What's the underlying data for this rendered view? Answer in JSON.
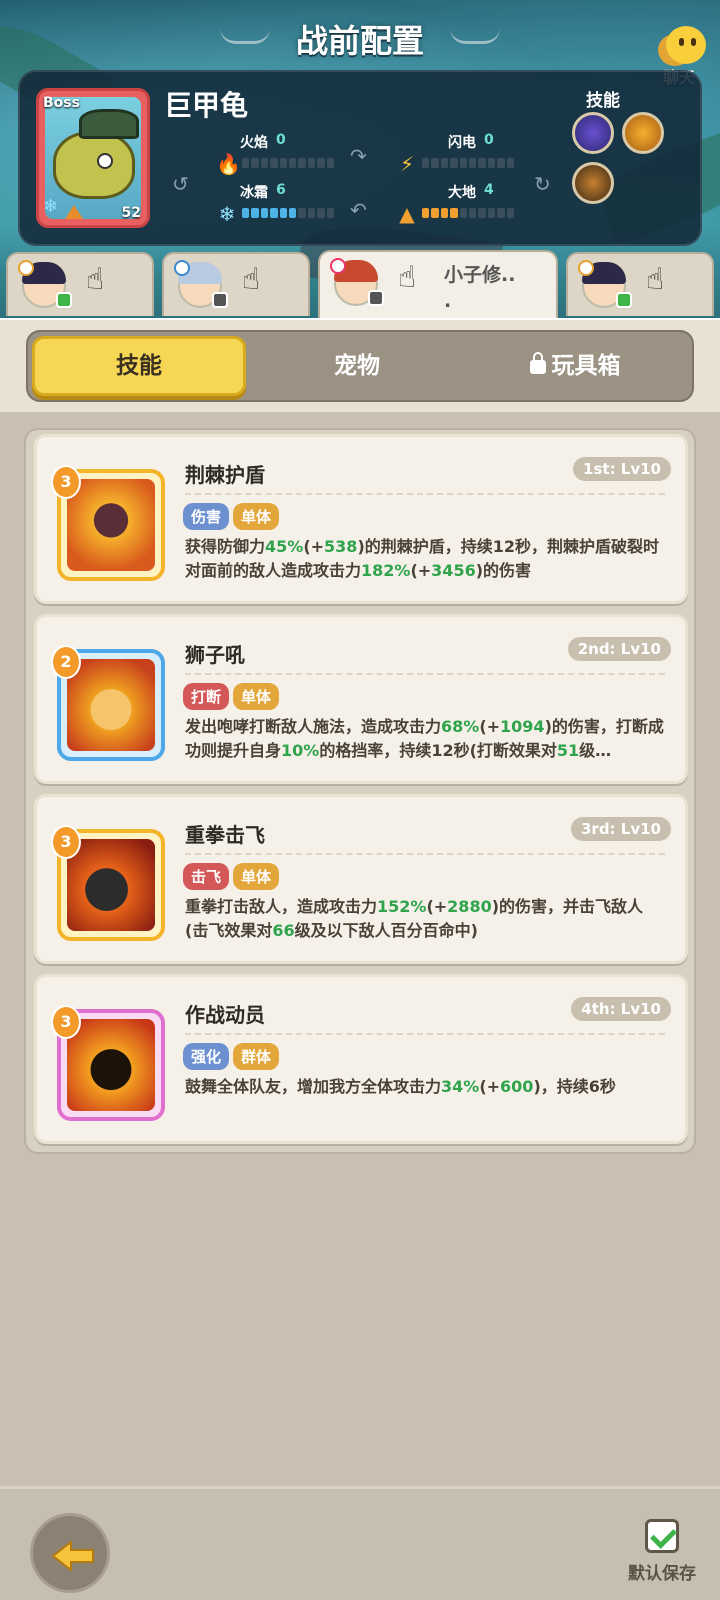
{
  "header": {
    "title": "战前配置",
    "chat_label": "聊天"
  },
  "boss": {
    "tag": "Boss",
    "name": "巨甲龟",
    "level": "52",
    "skills_label": "技能",
    "elements": [
      {
        "name": "火焰",
        "value": "0",
        "filled": 0,
        "icon": "fire-icon"
      },
      {
        "name": "闪电",
        "value": "0",
        "filled": 0,
        "icon": "lightning-icon"
      },
      {
        "name": "冰霜",
        "value": "6",
        "filled": 6,
        "icon": "frost-icon"
      },
      {
        "name": "大地",
        "value": "4",
        "filled": 4,
        "icon": "earth-icon"
      }
    ]
  },
  "heroes": [
    {
      "name": "",
      "hair": "#2c2848",
      "badge": "#3db54a"
    },
    {
      "name": "",
      "hair": "#b8cbe0",
      "badge": "#555"
    },
    {
      "name": "小子修..\n.",
      "hair": "#c84a2e",
      "badge": "#555",
      "active": true
    },
    {
      "name": "",
      "hair": "#2c2848",
      "badge": "#3db54a"
    }
  ],
  "tabs": {
    "skills": "技能",
    "pets": "宠物",
    "toybox": "玩具箱"
  },
  "skills": [
    {
      "level": "3",
      "name": "荆棘护盾",
      "rank": "1st: Lv10",
      "tags": [
        [
          "伤害",
          "blue"
        ],
        [
          "单体",
          "orange"
        ]
      ],
      "desc": [
        [
          "获得防御力",
          ""
        ],
        [
          "45%",
          "g"
        ],
        [
          "(+",
          ""
        ],
        [
          "538",
          "g"
        ],
        [
          ")的荆棘护盾，持续12秒，荆棘护盾破裂时对面前的敌人造成攻击力",
          ""
        ],
        [
          "182%",
          "g"
        ],
        [
          "(+",
          ""
        ],
        [
          "3456",
          "g"
        ],
        [
          ")的伤害",
          ""
        ]
      ]
    },
    {
      "level": "2",
      "name": "狮子吼",
      "rank": "2nd: Lv10",
      "tags": [
        [
          "打断",
          "red"
        ],
        [
          "单体",
          "orange"
        ]
      ],
      "desc": [
        [
          "发出咆哮打断敌人施法，造成攻击力",
          ""
        ],
        [
          "68%",
          "g"
        ],
        [
          "(+",
          ""
        ],
        [
          "1094",
          "g"
        ],
        [
          ")的伤害，打断成功则提升自身",
          ""
        ],
        [
          "10%",
          "g"
        ],
        [
          "的格挡率，持续12秒(打断效果对",
          ""
        ],
        [
          "51",
          "g"
        ],
        [
          "级…",
          ""
        ]
      ]
    },
    {
      "level": "3",
      "name": "重拳击飞",
      "rank": "3rd: Lv10",
      "tags": [
        [
          "击飞",
          "red"
        ],
        [
          "单体",
          "orange"
        ]
      ],
      "desc": [
        [
          "重拳打击敌人，造成攻击力",
          ""
        ],
        [
          "152%",
          "g"
        ],
        [
          "(+",
          ""
        ],
        [
          "2880",
          "g"
        ],
        [
          ")的伤害，并击飞敌人(击飞效果对",
          ""
        ],
        [
          "66",
          "g"
        ],
        [
          "级及以下敌人百分百命中)",
          ""
        ]
      ]
    },
    {
      "level": "3",
      "name": "作战动员",
      "rank": "4th: Lv10",
      "tags": [
        [
          "强化",
          "blue"
        ],
        [
          "群体",
          "orange"
        ]
      ],
      "desc": [
        [
          "鼓舞全体队友，增加我方全体攻击力",
          ""
        ],
        [
          "34%",
          "g"
        ],
        [
          "(+",
          ""
        ],
        [
          "600",
          "g"
        ],
        [
          ")，持续6秒",
          ""
        ]
      ]
    }
  ],
  "bottom": {
    "save_label": "默认保存"
  }
}
